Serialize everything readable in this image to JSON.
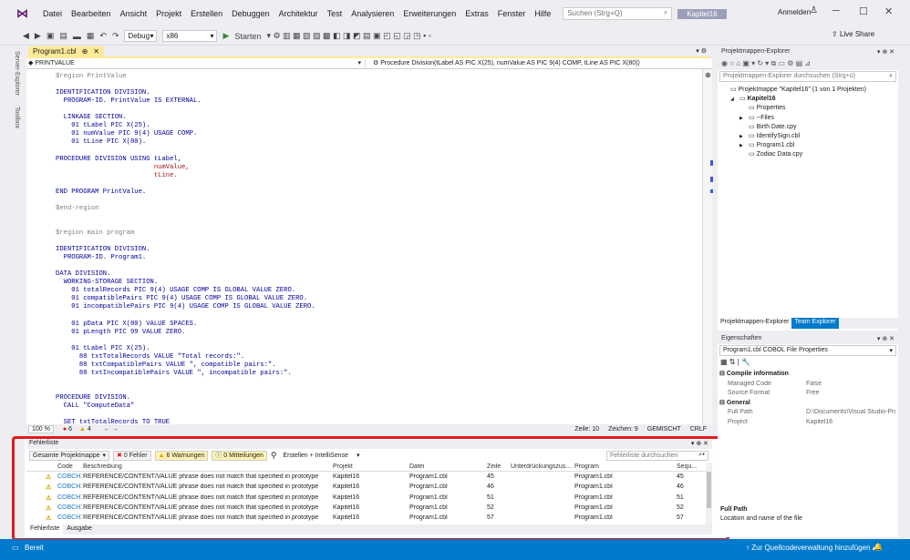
{
  "menu": {
    "items": [
      "Datei",
      "Bearbeiten",
      "Ansicht",
      "Projekt",
      "Erstellen",
      "Debuggen",
      "Architektur",
      "Test",
      "Analysieren",
      "Erweiterungen",
      "Extras",
      "Fenster",
      "Hilfe"
    ],
    "search_placeholder": "Suchen (Strg+Q)",
    "project_badge": "Kapitel16",
    "signin": "Anmelden"
  },
  "toolbar": {
    "config": "Debug",
    "platform": "x86",
    "start": "Starten",
    "liveshare": "Live Share"
  },
  "side_tabs": [
    "Server-Explorer",
    "Toolbox"
  ],
  "editor": {
    "tab": "Program1.cbl",
    "nav_left": "PRINTVALUE",
    "nav_right": "Procedure Division(tLabel AS PIC X(25), numValue AS PIC 9(4) COMP, tLine AS PIC X(80))",
    "lines": [
      {
        "t": "$region PrintValue",
        "c": "gray"
      },
      {
        "t": "",
        "c": ""
      },
      {
        "t": "IDENTIFICATION DIVISION.",
        "c": ""
      },
      {
        "t": "  PROGRAM-ID. PrintValue IS EXTERNAL.",
        "c": ""
      },
      {
        "t": "",
        "c": ""
      },
      {
        "t": "  LINKAGE SECTION.",
        "c": ""
      },
      {
        "t": "    01 tLabel PIC X(25).",
        "c": ""
      },
      {
        "t": "    01 numValue PIC 9(4) USAGE COMP.",
        "c": ""
      },
      {
        "t": "    01 tLine PIC X(80).",
        "c": ""
      },
      {
        "t": "",
        "c": ""
      },
      {
        "t": "PROCEDURE DIVISION USING tLabel,",
        "c": ""
      },
      {
        "t": "                         numValue,",
        "c": "var"
      },
      {
        "t": "                         tLine.",
        "c": "var"
      },
      {
        "t": "",
        "c": ""
      },
      {
        "t": "END PROGRAM PrintValue.",
        "c": ""
      },
      {
        "t": "",
        "c": ""
      },
      {
        "t": "$end-region",
        "c": "gray"
      },
      {
        "t": "",
        "c": ""
      },
      {
        "t": "",
        "c": ""
      },
      {
        "t": "$region main program",
        "c": "gray"
      },
      {
        "t": "",
        "c": ""
      },
      {
        "t": "IDENTIFICATION DIVISION.",
        "c": ""
      },
      {
        "t": "  PROGRAM-ID. Program1.",
        "c": ""
      },
      {
        "t": "",
        "c": ""
      },
      {
        "t": "DATA DIVISION.",
        "c": ""
      },
      {
        "t": "  WORKING-STORAGE SECTION.",
        "c": ""
      },
      {
        "t": "    01 totalRecords PIC 9(4) USAGE COMP IS GLOBAL VALUE ZERO.",
        "c": ""
      },
      {
        "t": "    01 compatiblePairs PIC 9(4) USAGE COMP IS GLOBAL VALUE ZERO.",
        "c": ""
      },
      {
        "t": "    01 incompatiblePairs PIC 9(4) USAGE COMP IS GLOBAL VALUE ZERO.",
        "c": ""
      },
      {
        "t": "",
        "c": ""
      },
      {
        "t": "    01 pData PIC X(80) VALUE SPACES.",
        "c": ""
      },
      {
        "t": "    01 pLength PIC 99 VALUE ZERO.",
        "c": ""
      },
      {
        "t": "",
        "c": ""
      },
      {
        "t": "    01 tLabel PIC X(25).",
        "c": ""
      },
      {
        "t": "      88 txtTotalRecords VALUE \"Total records:\".",
        "c": ""
      },
      {
        "t": "      88 txtCompatiblePairs VALUE \", compatible pairs:\".",
        "c": ""
      },
      {
        "t": "      88 txtIncompatiblePairs VALUE \", incompatible pairs:\".",
        "c": ""
      },
      {
        "t": "",
        "c": ""
      },
      {
        "t": "",
        "c": ""
      },
      {
        "t": "PROCEDURE DIVISION.",
        "c": ""
      },
      {
        "t": "  CALL \"ComputeData\"",
        "c": ""
      },
      {
        "t": "",
        "c": ""
      },
      {
        "t": "  SET txtTotalRecords TO TRUE",
        "c": ""
      }
    ],
    "zoom": "100 %",
    "errors": "6",
    "warnings": "4",
    "line": "Zeile: 10",
    "char": "Zeichen: 9",
    "mode": "GEMISCHT",
    "eol": "CRLF"
  },
  "errorlist": {
    "title": "Fehlerliste",
    "scope": "Gesamte Projektmappe",
    "errors_btn": "0 Fehler",
    "warnings_btn": "6 Warnungen",
    "messages_btn": "0 Mitteilungen",
    "build_filter": "Erstellen + IntelliSense",
    "search_placeholder": "Fehlerliste durchsuchen",
    "columns": [
      "Code",
      "Beschreibung",
      "Projekt",
      "Datei",
      "Zeile",
      "Unterdrückungszus...",
      "Program",
      "Sequ..."
    ],
    "rows": [
      {
        "code": "COBCH1",
        "desc": "REFERENCE/CONTENT/VALUE phrase does not match that specified in prototype",
        "project": "Kapitel16",
        "file": "Program1.cbl",
        "line": "45",
        "program": "Program1.cbl",
        "seq": "45"
      },
      {
        "code": "COBCH1",
        "desc": "REFERENCE/CONTENT/VALUE phrase does not match that specified in prototype",
        "project": "Kapitel16",
        "file": "Program1.cbl",
        "line": "46",
        "program": "Program1.cbl",
        "seq": "46"
      },
      {
        "code": "COBCH1",
        "desc": "REFERENCE/CONTENT/VALUE phrase does not match that specified in prototype",
        "project": "Kapitel16",
        "file": "Program1.cbl",
        "line": "51",
        "program": "Program1.cbl",
        "seq": "51"
      },
      {
        "code": "COBCH1",
        "desc": "REFERENCE/CONTENT/VALUE phrase does not match that specified in prototype",
        "project": "Kapitel16",
        "file": "Program1.cbl",
        "line": "52",
        "program": "Program1.cbl",
        "seq": "52"
      },
      {
        "code": "COBCH1",
        "desc": "REFERENCE/CONTENT/VALUE phrase does not match that specified in prototype",
        "project": "Kapitel16",
        "file": "Program1.cbl",
        "line": "57",
        "program": "Program1.cbl",
        "seq": "57"
      }
    ],
    "tab_active": "Fehlerliste",
    "tab_other": "Ausgabe"
  },
  "solution": {
    "title": "Projektmappen-Explorer",
    "search_placeholder": "Projektmappen-Explorer durchsuchen (Strg+ü)",
    "items": [
      {
        "label": "Projektmappe \"Kapitel16\" (1 von 1 Projekten)",
        "bold": false,
        "level": 0,
        "arrow": ""
      },
      {
        "label": "Kapitel16",
        "bold": true,
        "level": 1,
        "arrow": "◢"
      },
      {
        "label": "Properties",
        "bold": false,
        "level": 2,
        "arrow": ""
      },
      {
        "label": "--Files",
        "bold": false,
        "level": 2,
        "arrow": "▶"
      },
      {
        "label": "Birth Date.cpy",
        "bold": false,
        "level": 2,
        "arrow": ""
      },
      {
        "label": "IdentifySign.cbl",
        "bold": false,
        "level": 2,
        "arrow": "▶"
      },
      {
        "label": "Program1.cbl",
        "bold": false,
        "level": 2,
        "arrow": "▶"
      },
      {
        "label": "Zodiac Data.cpy",
        "bold": false,
        "level": 2,
        "arrow": ""
      }
    ],
    "tab_active": "Projektmappen-Explorer",
    "tab_other": "Team Explorer"
  },
  "properties": {
    "title": "Eigenschaften",
    "object": "Program1.cbl COBOL File Properties",
    "sections": [
      {
        "name": "Compile information",
        "rows": [
          [
            "Managed Code",
            "False"
          ],
          [
            "Source Format",
            "Free"
          ]
        ]
      },
      {
        "name": "General",
        "rows": [
          [
            "Full Path",
            "D:\\Documents\\Visual Studio-Pro"
          ],
          [
            "Project",
            "Kapitel16"
          ]
        ]
      }
    ],
    "desc_title": "Full Path",
    "desc_text": "Location and name of the file"
  },
  "status": {
    "ready": "Bereit",
    "scm": "Zur Quellcodeverwaltung hinzufügen"
  }
}
